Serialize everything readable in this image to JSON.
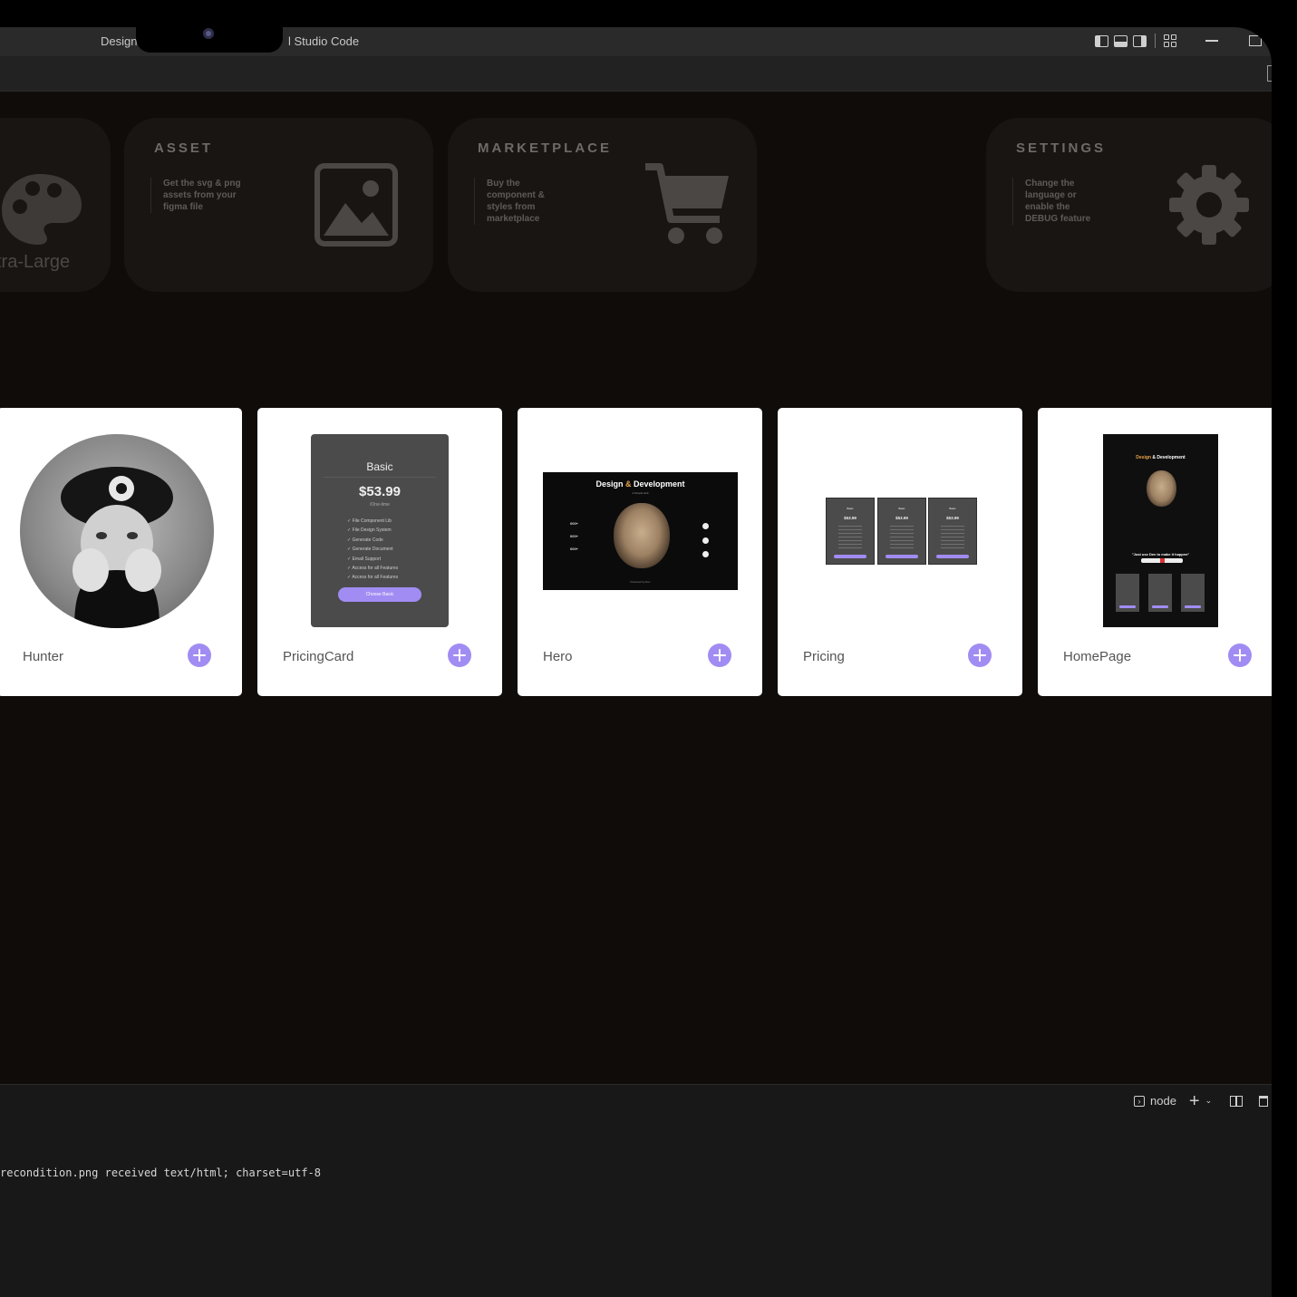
{
  "window": {
    "title_left": "Design",
    "title_right": "l Studio Code"
  },
  "feature_cards": [
    {
      "title": "",
      "label": "tra-Large",
      "icon": "palette-icon"
    },
    {
      "title": "ASSET",
      "description": "Get the svg & png assets from your figma file",
      "icon": "image-icon"
    },
    {
      "title": "MARKETPLACE",
      "description": "Buy the component & styles from marketplace",
      "icon": "cart-icon"
    },
    {
      "title": "SETTINGS",
      "description": "Change the language or enable the DEBUG feature",
      "icon": "gear-icon"
    }
  ],
  "components": [
    {
      "name": "Hunter"
    },
    {
      "name": "PricingCard",
      "preview": {
        "plan": "Basic",
        "price": "$53.99",
        "period": "/One-time",
        "features": [
          "File Component Lib",
          "File Design System",
          "Generate Code",
          "Generate Document",
          "Email Support",
          "Access for all Features",
          "Access for all Features"
        ],
        "button": "Choose Basic"
      }
    },
    {
      "name": "Hero",
      "preview": {
        "title_a": "Design ",
        "title_b": "& ",
        "title_c": "Development",
        "subtitle": "A Simple Hub",
        "stats": [
          "000+",
          "000+",
          "000+"
        ],
        "footer": "Powered by Dev"
      }
    },
    {
      "name": "Pricing",
      "preview": {
        "plan": "Basic",
        "price": "$53.99"
      }
    },
    {
      "name": "HomePage",
      "preview": {
        "title_a": "Design ",
        "title_b": "& Development",
        "quote": "\"Just use Dev to make it happen\""
      }
    }
  ],
  "terminal": {
    "shell": "node",
    "output": "recondition.png received text/html; charset=utf-8"
  },
  "colors": {
    "accent": "#a18cf3",
    "background": "#100c09",
    "card": "#181513"
  }
}
